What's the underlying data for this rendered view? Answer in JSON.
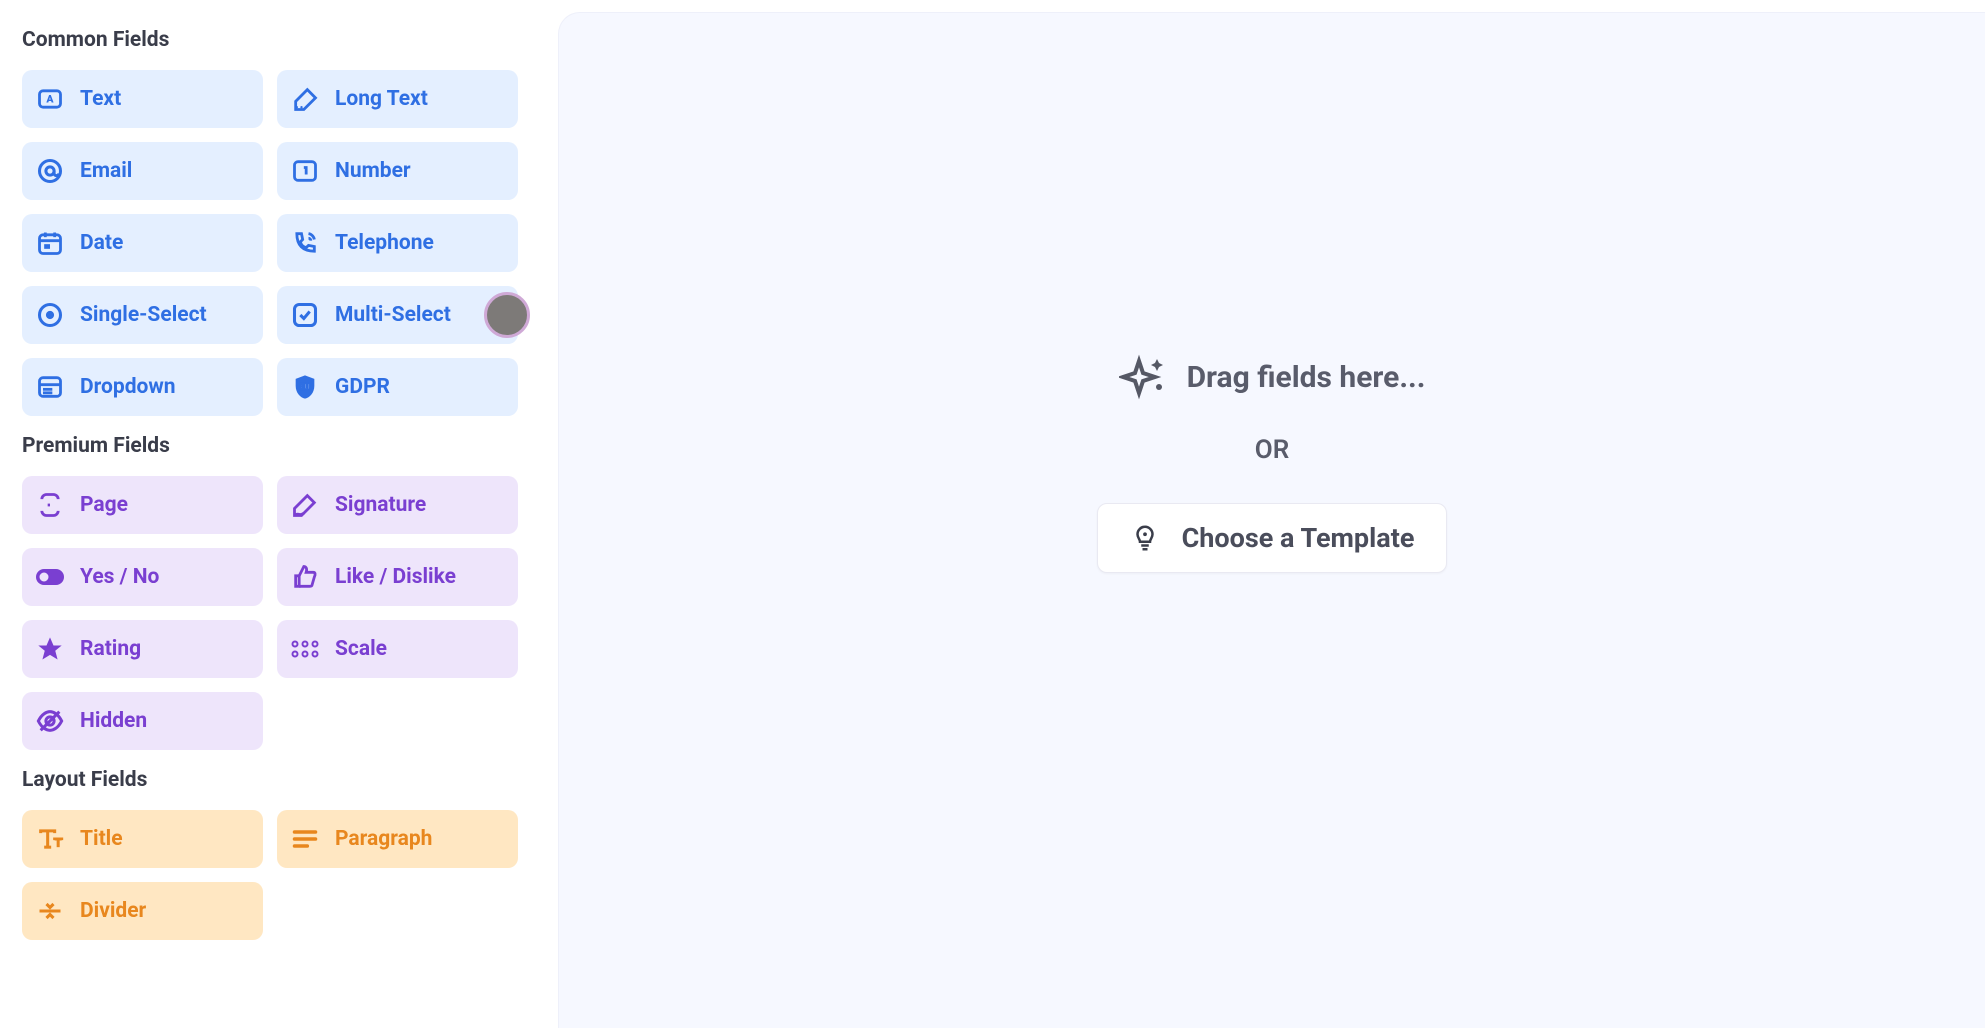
{
  "sections": {
    "common": {
      "title": "Common Fields",
      "items": [
        {
          "label": "Text"
        },
        {
          "label": "Long Text"
        },
        {
          "label": "Email"
        },
        {
          "label": "Number"
        },
        {
          "label": "Date"
        },
        {
          "label": "Telephone"
        },
        {
          "label": "Single-Select"
        },
        {
          "label": "Multi-Select"
        },
        {
          "label": "Dropdown"
        },
        {
          "label": "GDPR"
        }
      ]
    },
    "premium": {
      "title": "Premium Fields",
      "items": [
        {
          "label": "Page"
        },
        {
          "label": "Signature"
        },
        {
          "label": "Yes / No"
        },
        {
          "label": "Like / Dislike"
        },
        {
          "label": "Rating"
        },
        {
          "label": "Scale"
        },
        {
          "label": "Hidden"
        }
      ]
    },
    "layout": {
      "title": "Layout Fields",
      "items": [
        {
          "label": "Title"
        },
        {
          "label": "Paragraph"
        },
        {
          "label": "Divider"
        }
      ]
    }
  },
  "canvas": {
    "drag_hint": "Drag fields here...",
    "or_label": "OR",
    "template_button": "Choose a Template"
  }
}
